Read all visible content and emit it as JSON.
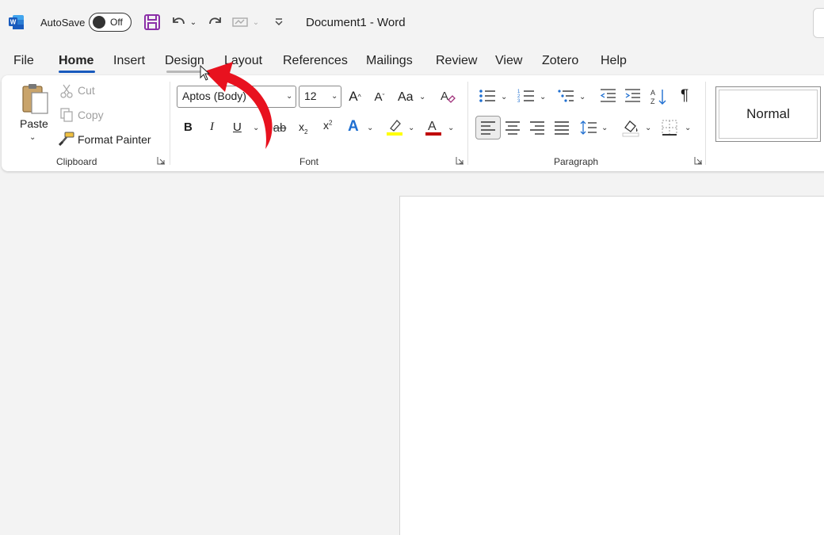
{
  "titlebar": {
    "autosave_label": "AutoSave",
    "autosave_state": "Off",
    "document_title": "Document1  -  Word"
  },
  "tabs": [
    "File",
    "Home",
    "Insert",
    "Design",
    "Layout",
    "References",
    "Mailings",
    "Review",
    "View",
    "Zotero",
    "Help"
  ],
  "clipboard": {
    "paste_label": "Paste",
    "cut_label": "Cut",
    "copy_label": "Copy",
    "format_painter_label": "Format Painter",
    "group_label": "Clipboard"
  },
  "font": {
    "font_name": "Aptos (Body)",
    "font_size": "12",
    "change_case_label": "Aa",
    "bold": "B",
    "italic": "I",
    "underline": "U",
    "subscript": "x",
    "superscript": "x",
    "text_effects_glyph": "A",
    "font_color_glyph": "A",
    "group_label": "Font"
  },
  "paragraph": {
    "pilcrow": "¶",
    "group_label": "Paragraph"
  },
  "styles": {
    "normal_label": "Normal"
  },
  "colors": {
    "accent": "#185abd",
    "highlight": "#ffff00",
    "font_color": "#c00000",
    "annotation_arrow": "#e8121f"
  }
}
